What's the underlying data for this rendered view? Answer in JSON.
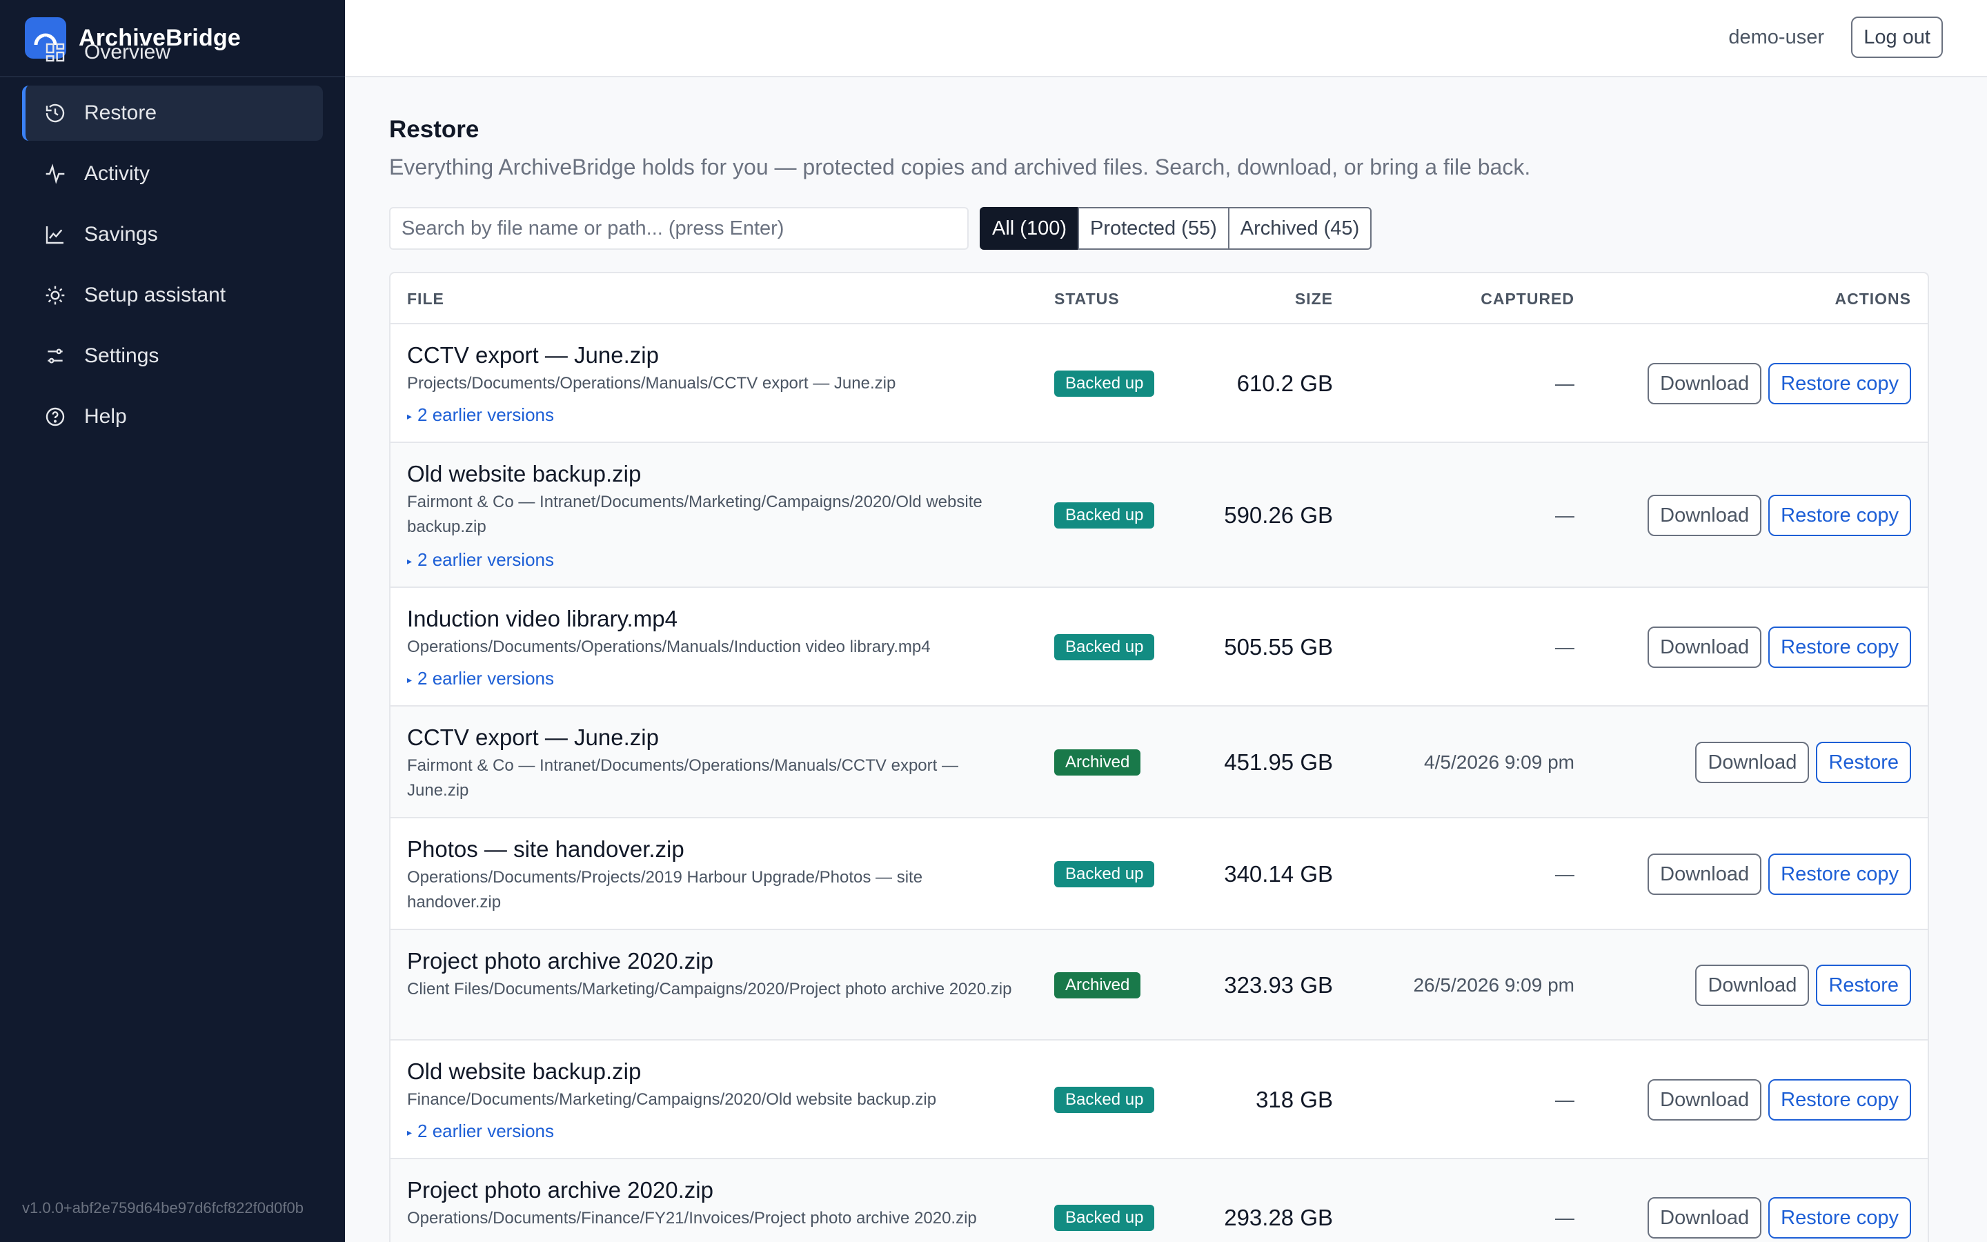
{
  "app": {
    "name": "ArchiveBridge",
    "version": "v1.0.0+abf2e759d64be97d6fcf822f0d0f0b"
  },
  "colors": {
    "sidebar_bg": "#111a2e",
    "accent": "#2f6ee6",
    "badge_backed": "#128c82",
    "badge_archived": "#19794a",
    "link": "#1d5fd6"
  },
  "nav": [
    {
      "label": "Overview",
      "icon": "grid-icon"
    },
    {
      "label": "Restore",
      "icon": "history-icon",
      "active": true
    },
    {
      "label": "Activity",
      "icon": "pulse-icon"
    },
    {
      "label": "Savings",
      "icon": "line-chart-icon"
    },
    {
      "label": "Setup assistant",
      "icon": "sun-gear-icon"
    },
    {
      "label": "Settings",
      "icon": "sliders-icon"
    },
    {
      "label": "Help",
      "icon": "help-circle-icon"
    }
  ],
  "topbar": {
    "username": "demo-user",
    "logout_label": "Log out"
  },
  "page": {
    "title": "Restore",
    "subtitle": "Everything ArchiveBridge holds for you — protected copies and archived files. Search, download, or bring a file back.",
    "search_placeholder": "Search by file name or path... (press Enter)",
    "filters": [
      "All (100)",
      "Protected (55)",
      "Archived (45)"
    ],
    "selected_filter": "All (100)"
  },
  "table": {
    "headers": {
      "file": "FILE",
      "status": "STATUS",
      "size": "SIZE",
      "captured": "CAPTURED",
      "actions": "ACTIONS"
    },
    "rows": [
      {
        "name": "CCTV export — June.zip",
        "path": "Projects/Documents/Operations/Manuals/CCTV export — June.zip",
        "versions": "2 earlier versions",
        "status": "Backed up",
        "size": "610.2 GB",
        "captured": "—",
        "download": "Download",
        "restore": "Restore copy"
      },
      {
        "name": "Old website backup.zip",
        "path": "Fairmont & Co — Intranet/Documents/Marketing/Campaigns/2020/Old website backup.zip",
        "versions": "2 earlier versions",
        "status": "Backed up",
        "size": "590.26 GB",
        "captured": "—",
        "download": "Download",
        "restore": "Restore copy"
      },
      {
        "name": "Induction video library.mp4",
        "path": "Operations/Documents/Operations/Manuals/Induction video library.mp4",
        "versions": "2 earlier versions",
        "status": "Backed up",
        "size": "505.55 GB",
        "captured": "—",
        "download": "Download",
        "restore": "Restore copy"
      },
      {
        "name": "CCTV export — June.zip",
        "path": "Fairmont & Co — Intranet/Documents/Operations/Manuals/CCTV export — June.zip",
        "versions": "",
        "status": "Archived",
        "size": "451.95 GB",
        "captured": "4/5/2026 9:09 pm",
        "download": "Download",
        "restore": "Restore"
      },
      {
        "name": "Photos — site handover.zip",
        "path": "Operations/Documents/Projects/2019 Harbour Upgrade/Photos — site handover.zip",
        "versions": "",
        "status": "Backed up",
        "size": "340.14 GB",
        "captured": "—",
        "download": "Download",
        "restore": "Restore copy"
      },
      {
        "name": "Project photo archive 2020.zip",
        "path": "Client Files/Documents/Marketing/Campaigns/2020/Project photo archive 2020.zip",
        "versions": "",
        "status": "Archived",
        "size": "323.93 GB",
        "captured": "26/5/2026 9:09 pm",
        "download": "Download",
        "restore": "Restore"
      },
      {
        "name": "Old website backup.zip",
        "path": "Finance/Documents/Marketing/Campaigns/2020/Old website backup.zip",
        "versions": "2 earlier versions",
        "status": "Backed up",
        "size": "318 GB",
        "captured": "—",
        "download": "Download",
        "restore": "Restore copy"
      },
      {
        "name": "Project photo archive 2020.zip",
        "path": "Operations/Documents/Finance/FY21/Invoices/Project photo archive 2020.zip",
        "versions": "",
        "status": "Backed up",
        "size": "293.28 GB",
        "captured": "—",
        "download": "Download",
        "restore": "Restore copy"
      }
    ]
  }
}
